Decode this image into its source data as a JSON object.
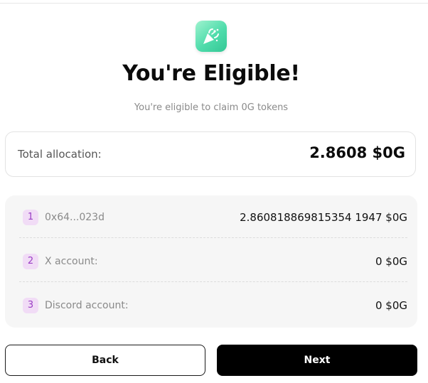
{
  "header": {
    "logo_icon": "party-popper-icon",
    "title": "You're Eligible!",
    "subtitle": "You're eligible to claim 0G tokens"
  },
  "allocation": {
    "label": "Total allocation:",
    "value": "2.8608 $0G"
  },
  "breakdown": [
    {
      "index": "1",
      "label": "0x64...023d",
      "value": "2.860818869815354 1947 $0G"
    },
    {
      "index": "2",
      "label": "X account:",
      "value": "0 $0G"
    },
    {
      "index": "3",
      "label": "Discord account:",
      "value": "0 $0G"
    }
  ],
  "buttons": {
    "back": "Back",
    "next": "Next"
  },
  "colors": {
    "accent_green": "#4fdcab",
    "badge_bg": "#f1dcf6",
    "badge_text": "#9a3ec4",
    "primary_button": "#000000"
  }
}
